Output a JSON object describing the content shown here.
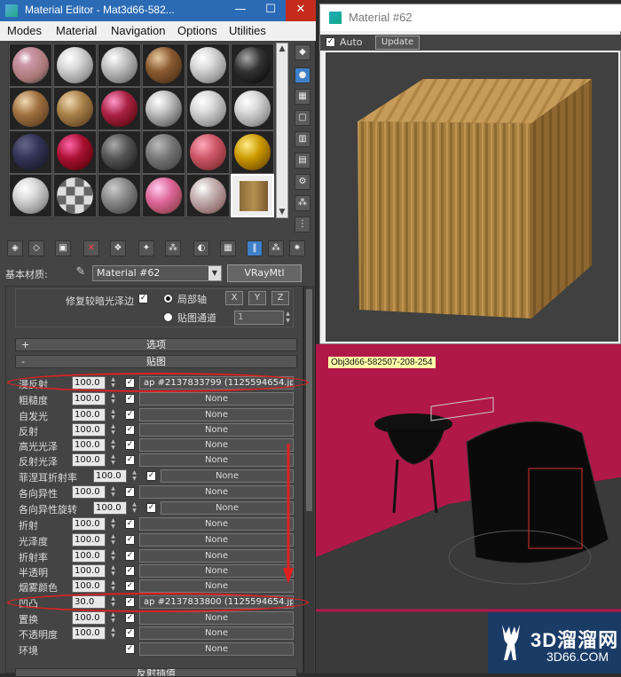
{
  "material_editor": {
    "title": "Material Editor - Mat3d66-582...",
    "window_controls": {
      "minimize": "—",
      "maximize": "☐",
      "close": "✕"
    },
    "menu": [
      "Modes",
      "Material",
      "Navigation",
      "Options",
      "Utilities"
    ],
    "material_name_label": "基本材质:",
    "material_name": "Material #62",
    "material_type": "VRayMtl",
    "basic": {
      "fix_dark_label": "修复较暗光泽边",
      "fix_dark_checked": "✓",
      "local_axis_label": "局部轴",
      "axis_x": "X",
      "axis_y": "Y",
      "axis_z": "Z",
      "map_channel_label": "贴图通道",
      "map_channel_value": "1"
    },
    "rollouts": {
      "options": {
        "sign": "+",
        "label": "选项"
      },
      "maps": {
        "sign": "-",
        "label": "贴图"
      },
      "reflect_interp": {
        "label": "反射插值"
      }
    },
    "maps": [
      {
        "label": "漫反射",
        "amount": "100.0",
        "checked": "✓",
        "map": "ap #2137833799 (1125594654.jpg)"
      },
      {
        "label": "粗糙度",
        "amount": "100.0",
        "checked": "✓",
        "map": "None"
      },
      {
        "label": "自发光",
        "amount": "100.0",
        "checked": "✓",
        "map": "None"
      },
      {
        "label": "反射",
        "amount": "100.0",
        "checked": "✓",
        "map": "None"
      },
      {
        "label": "高光光泽",
        "amount": "100.0",
        "checked": "✓",
        "map": "None"
      },
      {
        "label": "反射光泽",
        "amount": "100.0",
        "checked": "✓",
        "map": "None"
      },
      {
        "label": "菲涅耳折射率",
        "amount": "100.0",
        "checked": "✓",
        "map": "None"
      },
      {
        "label": "各向异性",
        "amount": "100.0",
        "checked": "✓",
        "map": "None"
      },
      {
        "label": "各向异性旋转",
        "amount": "100.0",
        "checked": "✓",
        "map": "None"
      },
      {
        "label": "折射",
        "amount": "100.0",
        "checked": "✓",
        "map": "None"
      },
      {
        "label": "光泽度",
        "amount": "100.0",
        "checked": "✓",
        "map": "None"
      },
      {
        "label": "折射率",
        "amount": "100.0",
        "checked": "✓",
        "map": "None"
      },
      {
        "label": "半透明",
        "amount": "100.0",
        "checked": "✓",
        "map": "None"
      },
      {
        "label": "烟雾颜色",
        "amount": "100.0",
        "checked": "✓",
        "map": "None"
      },
      {
        "label": "凹凸",
        "amount": "30.0",
        "checked": "✓",
        "map": "ap #2137833800 (1125594654.jpg)"
      },
      {
        "label": "置换",
        "amount": "100.0",
        "checked": "✓",
        "map": "None"
      },
      {
        "label": "不透明度",
        "amount": "100.0",
        "checked": "✓",
        "map": "None"
      },
      {
        "label": "环境",
        "amount": "",
        "checked": "✓",
        "map": "None"
      }
    ]
  },
  "viewer": {
    "title": "Material #62",
    "auto_label": "Auto",
    "auto_checked": "✓",
    "update_label": "Update"
  },
  "scene": {
    "object_label": "Obj3d66-582507-208-254"
  },
  "watermark": {
    "brand": "3D溜溜网",
    "url": "3D66.COM"
  },
  "colors": {
    "accent_blue": "#2b6bb5",
    "highlight_red": "#e02020",
    "scene_magenta": "#b0184a"
  }
}
